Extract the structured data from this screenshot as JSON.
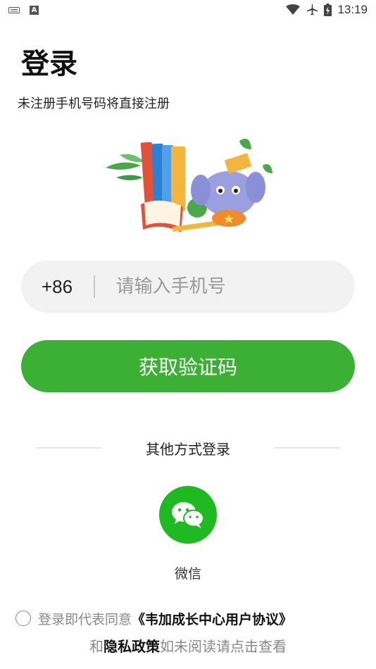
{
  "status_bar": {
    "time": "13:19",
    "icons": [
      "keyboard-icon",
      "a-icon",
      "wifi-icon",
      "airplane-icon",
      "battery-icon"
    ],
    "a_icon_text": "A"
  },
  "login": {
    "title": "登录",
    "subtitle": "未注册手机号码将直接注册"
  },
  "phone": {
    "country_code": "+86",
    "placeholder": "请输入手机号",
    "value": ""
  },
  "code_button": {
    "label": "获取验证码",
    "color": "#3cb035"
  },
  "other_login": {
    "label": "其他方式登录",
    "wechat_label": "微信",
    "wechat_color": "#1fb922"
  },
  "agreement": {
    "text_before": "登录即代表同意",
    "user_agreement": "《韦加成长中心用户协议》",
    "and": "和",
    "privacy": "隐私政策",
    "text_after": "如未阅读请点击查看",
    "checked": false
  }
}
